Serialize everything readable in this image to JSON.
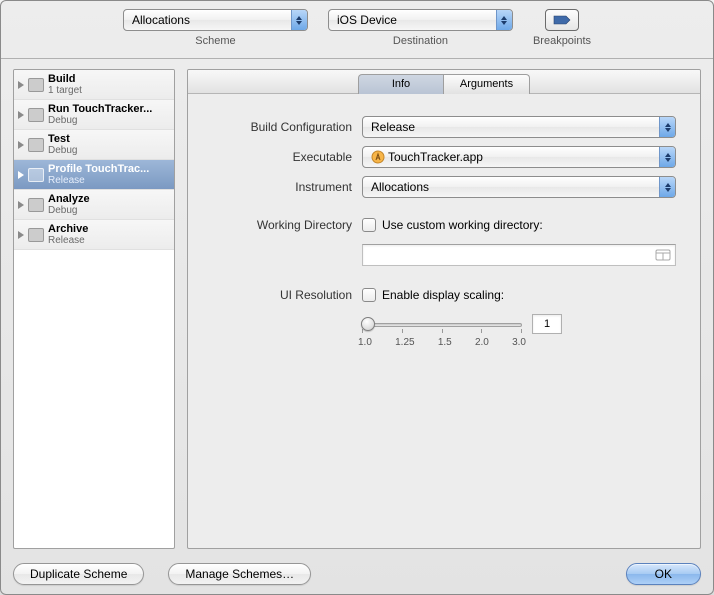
{
  "toolbar": {
    "scheme": {
      "value": "Allocations",
      "label": "Scheme"
    },
    "destination": {
      "value": "iOS Device",
      "label": "Destination"
    },
    "breakpoints": {
      "label": "Breakpoints"
    }
  },
  "sidebar": {
    "items": [
      {
        "title": "Build",
        "sub": "1 target"
      },
      {
        "title": "Run TouchTracker...",
        "sub": "Debug"
      },
      {
        "title": "Test",
        "sub": "Debug"
      },
      {
        "title": "Profile TouchTrac...",
        "sub": "Release"
      },
      {
        "title": "Analyze",
        "sub": "Debug"
      },
      {
        "title": "Archive",
        "sub": "Release"
      }
    ],
    "selected_index": 3
  },
  "tabs": {
    "items": [
      "Info",
      "Arguments"
    ],
    "active_index": 0
  },
  "form": {
    "build_config": {
      "label": "Build Configuration",
      "value": "Release"
    },
    "executable": {
      "label": "Executable",
      "value": "TouchTracker.app"
    },
    "instrument": {
      "label": "Instrument",
      "value": "Allocations"
    },
    "workdir": {
      "label": "Working Directory",
      "check_label": "Use custom working directory:",
      "path": ""
    },
    "ui_res": {
      "label": "UI Resolution",
      "check_label": "Enable display scaling:",
      "value": "1",
      "ticks": [
        "1.0",
        "1.25",
        "1.5",
        "2.0",
        "3.0"
      ]
    }
  },
  "footer": {
    "duplicate": "Duplicate Scheme",
    "manage": "Manage Schemes…",
    "ok": "OK"
  }
}
